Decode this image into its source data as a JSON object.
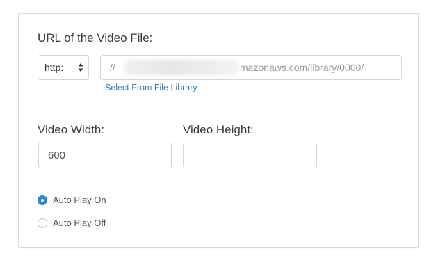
{
  "form": {
    "url_label": "URL of the Video File:",
    "protocol": {
      "selected": "http:"
    },
    "url_field": {
      "prefix": "//",
      "visible_suffix": "mazonaws.com/library/0000/"
    },
    "file_library_link": "Select From File Library",
    "width_label": "Video Width:",
    "width_value": "600",
    "height_label": "Video Height:",
    "height_value": "",
    "autoplay": [
      {
        "label": "Auto Play On",
        "checked": true
      },
      {
        "label": "Auto Play Off",
        "checked": false
      }
    ]
  },
  "colors": {
    "accent": "#2f86d6",
    "link": "#2b7bb9",
    "border": "#d6d6d6"
  }
}
